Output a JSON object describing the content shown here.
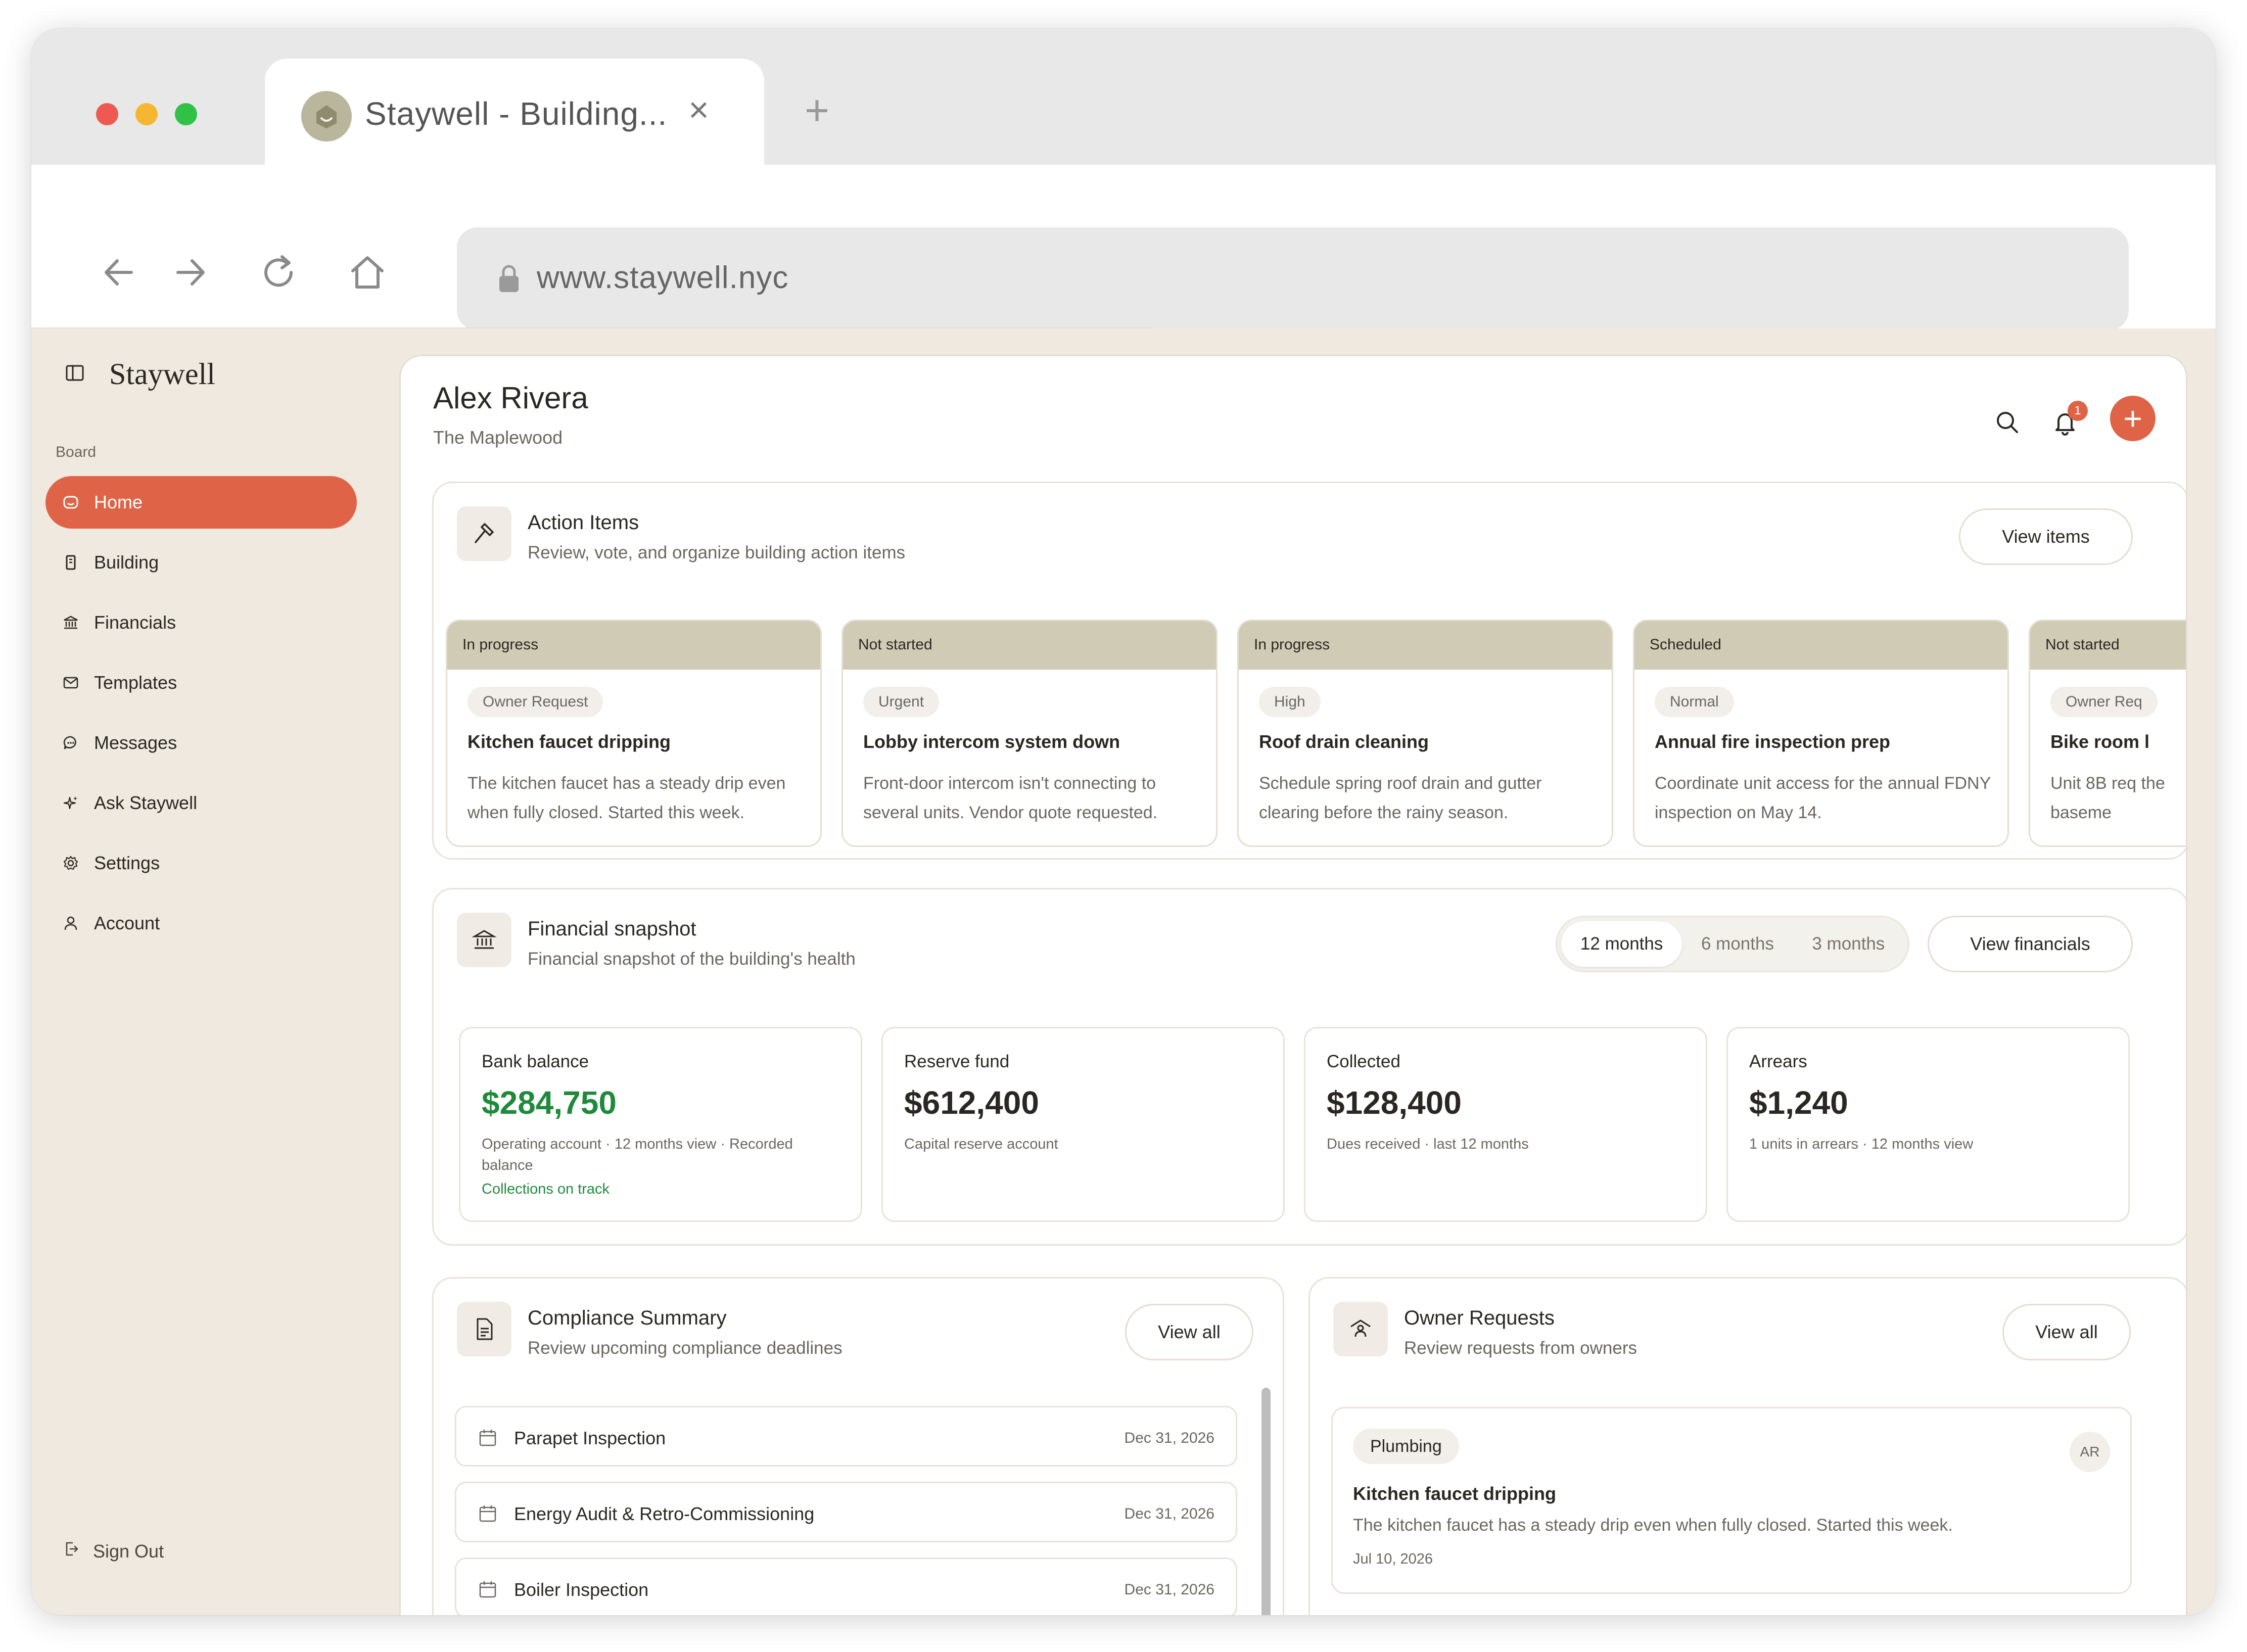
{
  "browser": {
    "tab_title": "Staywell - Building...",
    "url": "www.staywell.nyc",
    "traffic_colors": [
      "#ee5a52",
      "#f5b731",
      "#2fc246"
    ]
  },
  "sidebar": {
    "brand": "Staywell",
    "section_label": "Board",
    "items": [
      {
        "label": "Home",
        "icon": "home-icon",
        "active": true
      },
      {
        "label": "Building",
        "icon": "building-icon"
      },
      {
        "label": "Financials",
        "icon": "bank-icon"
      },
      {
        "label": "Templates",
        "icon": "template-icon"
      },
      {
        "label": "Messages",
        "icon": "message-icon"
      },
      {
        "label": "Ask Staywell",
        "icon": "sparkle-icon"
      },
      {
        "label": "Settings",
        "icon": "gear-icon"
      },
      {
        "label": "Account",
        "icon": "user-icon"
      }
    ],
    "signout": "Sign Out"
  },
  "header": {
    "title": "Alex Rivera",
    "subtitle": "The Maplewood",
    "notification_count": "1",
    "add_label": "+"
  },
  "action_items": {
    "title": "Action Items",
    "subtitle": "Review, vote, and organize building action items",
    "button": "View items",
    "cards": [
      {
        "status": "In progress",
        "tag": "Owner Request",
        "title": "Kitchen faucet dripping",
        "desc": "The kitchen faucet has a steady drip even when fully closed. Started this week."
      },
      {
        "status": "Not started",
        "tag": "Urgent",
        "title": "Lobby intercom system down",
        "desc": "Front-door intercom isn't connecting to several units. Vendor quote requested."
      },
      {
        "status": "In progress",
        "tag": "High",
        "title": "Roof drain cleaning",
        "desc": "Schedule spring roof drain and gutter clearing before the rainy season."
      },
      {
        "status": "Scheduled",
        "tag": "Normal",
        "title": "Annual fire inspection prep",
        "desc": "Coordinate unit access for the annual FDNY inspection on May 14."
      },
      {
        "status": "Not started",
        "tag": "Owner Req",
        "title": "Bike room l",
        "desc": "Unit 8B req the baseme"
      }
    ]
  },
  "financial": {
    "title": "Financial snapshot",
    "subtitle": "Financial snapshot of the building's health",
    "ranges": [
      "12 months",
      "6 months",
      "3 months"
    ],
    "active_range": "12 months",
    "button": "View financials",
    "stats": [
      {
        "label": "Bank balance",
        "value": "$284,750",
        "note": "Operating account · 12 months view · Recorded balance",
        "status": "Collections on track"
      },
      {
        "label": "Reserve fund",
        "value": "$612,400",
        "note": "Capital reserve account"
      },
      {
        "label": "Collected",
        "value": "$128,400",
        "note": "Dues received · last 12 months"
      },
      {
        "label": "Arrears",
        "value": "$1,240",
        "note": "1 units in arrears · 12 months view"
      }
    ],
    "positive_color": "#208a3c"
  },
  "compliance": {
    "title": "Compliance Summary",
    "subtitle": "Review upcoming compliance deadlines",
    "button": "View all",
    "rows": [
      {
        "name": "Parapet Inspection",
        "date": "Dec 31, 2026"
      },
      {
        "name": "Energy Audit & Retro-Commissioning",
        "date": "Dec 31, 2026"
      },
      {
        "name": "Boiler Inspection",
        "date": "Dec 31, 2026"
      }
    ]
  },
  "owner_requests": {
    "title": "Owner Requests",
    "subtitle": "Review requests from owners",
    "button": "View all",
    "request": {
      "tag": "Plumbing",
      "avatar": "AR",
      "title": "Kitchen faucet dripping",
      "desc": "The kitchen faucet has a steady drip even when fully closed. Started this week.",
      "date": "Jul 10, 2026"
    }
  },
  "accent_color": "#df6447"
}
